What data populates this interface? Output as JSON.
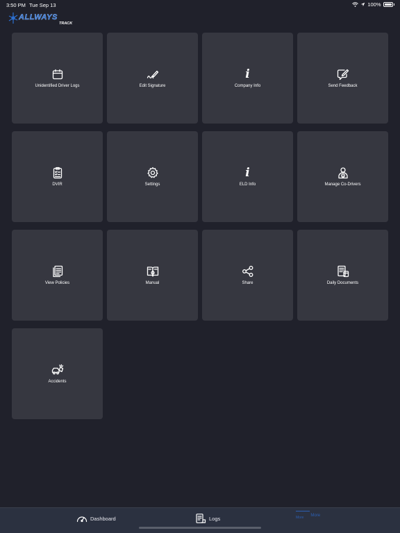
{
  "status_bar": {
    "time": "3:50 PM",
    "date": "Tue Sep 13",
    "battery": "100%"
  },
  "brand": {
    "logo_top": "ALLWAYS",
    "logo_bottom": "TRACK",
    "accent_color": "#2c6fd0"
  },
  "tiles": [
    {
      "label": "Unidentified Driver Logs",
      "icon": "calendar-icon"
    },
    {
      "label": "Edit Signature",
      "icon": "signature-pen-icon"
    },
    {
      "label": "Company Info",
      "icon": "info-icon"
    },
    {
      "label": "Send Feedback",
      "icon": "feedback-pen-icon"
    },
    {
      "label": "DVIR",
      "icon": "clipboard-checklist-icon"
    },
    {
      "label": "Settings",
      "icon": "gear-icon"
    },
    {
      "label": "ELD Info",
      "icon": "info-icon"
    },
    {
      "label": "Manage Co-Drivers",
      "icon": "driver-user-icon"
    },
    {
      "label": "View Policies",
      "icon": "policies-document-icon"
    },
    {
      "label": "Manual",
      "icon": "manual-book-icon"
    },
    {
      "label": "Share",
      "icon": "share-icon"
    },
    {
      "label": "Daily Documents",
      "icon": "documents-icon"
    },
    {
      "label": "Accidents",
      "icon": "car-accident-icon"
    }
  ],
  "tab_bar": {
    "dashboard": "Dashboard",
    "logs": "Logs",
    "more_left": "More",
    "more_right": "More",
    "active_color": "#2c5fb3"
  }
}
